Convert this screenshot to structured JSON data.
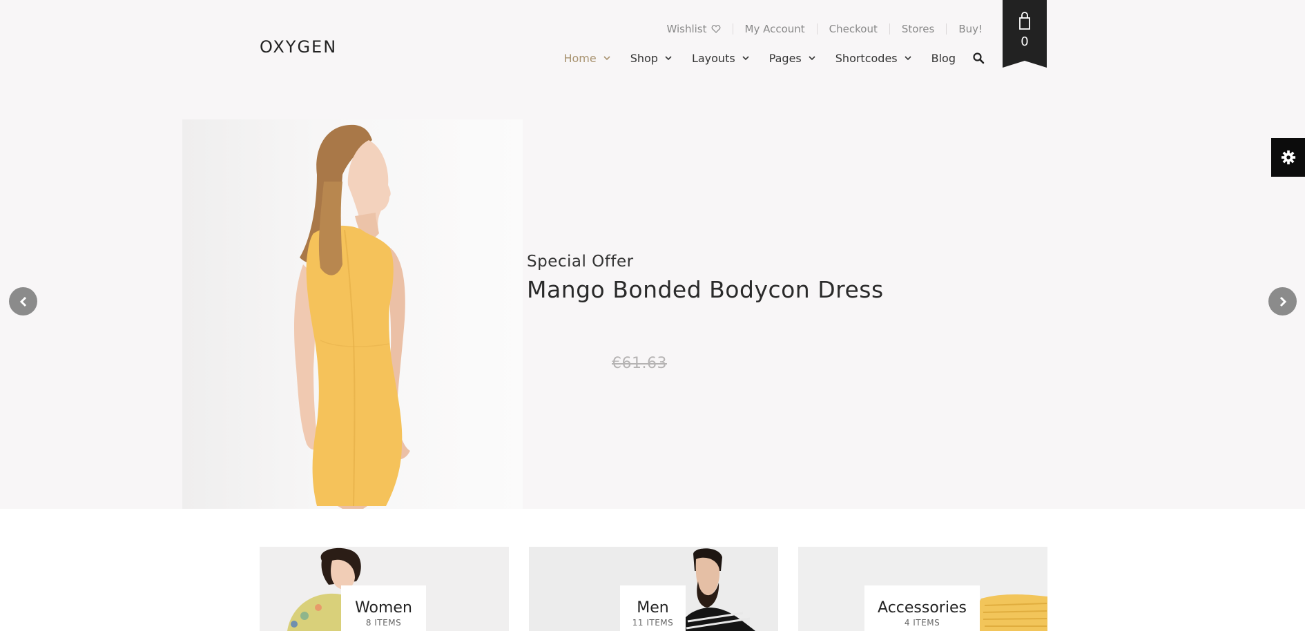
{
  "header": {
    "logo": "OXYGEN",
    "top_links": [
      {
        "label": "Wishlist",
        "icon": "heart-icon"
      },
      {
        "label": "My Account"
      },
      {
        "label": "Checkout"
      },
      {
        "label": "Stores"
      },
      {
        "label": "Buy!"
      }
    ],
    "nav": [
      {
        "label": "Home",
        "active": true,
        "dropdown": true
      },
      {
        "label": "Shop",
        "dropdown": true
      },
      {
        "label": "Layouts",
        "dropdown": true
      },
      {
        "label": "Pages",
        "dropdown": true
      },
      {
        "label": "Shortcodes",
        "dropdown": true
      },
      {
        "label": "Blog",
        "dropdown": false
      }
    ],
    "cart_count": "0"
  },
  "hero": {
    "subtitle": "Special Offer",
    "title": "Mango Bonded Bodycon Dress",
    "price": "€61.63"
  },
  "categories": [
    {
      "name": "Women",
      "count": "8 ITEMS"
    },
    {
      "name": "Men",
      "count": "11 ITEMS"
    },
    {
      "name": "Accessories",
      "count": "4 ITEMS"
    }
  ],
  "colors": {
    "accent": "#a8926f",
    "hero_bg": "#f8f6f7",
    "dark": "#222222",
    "dress": "#f5c25a"
  }
}
